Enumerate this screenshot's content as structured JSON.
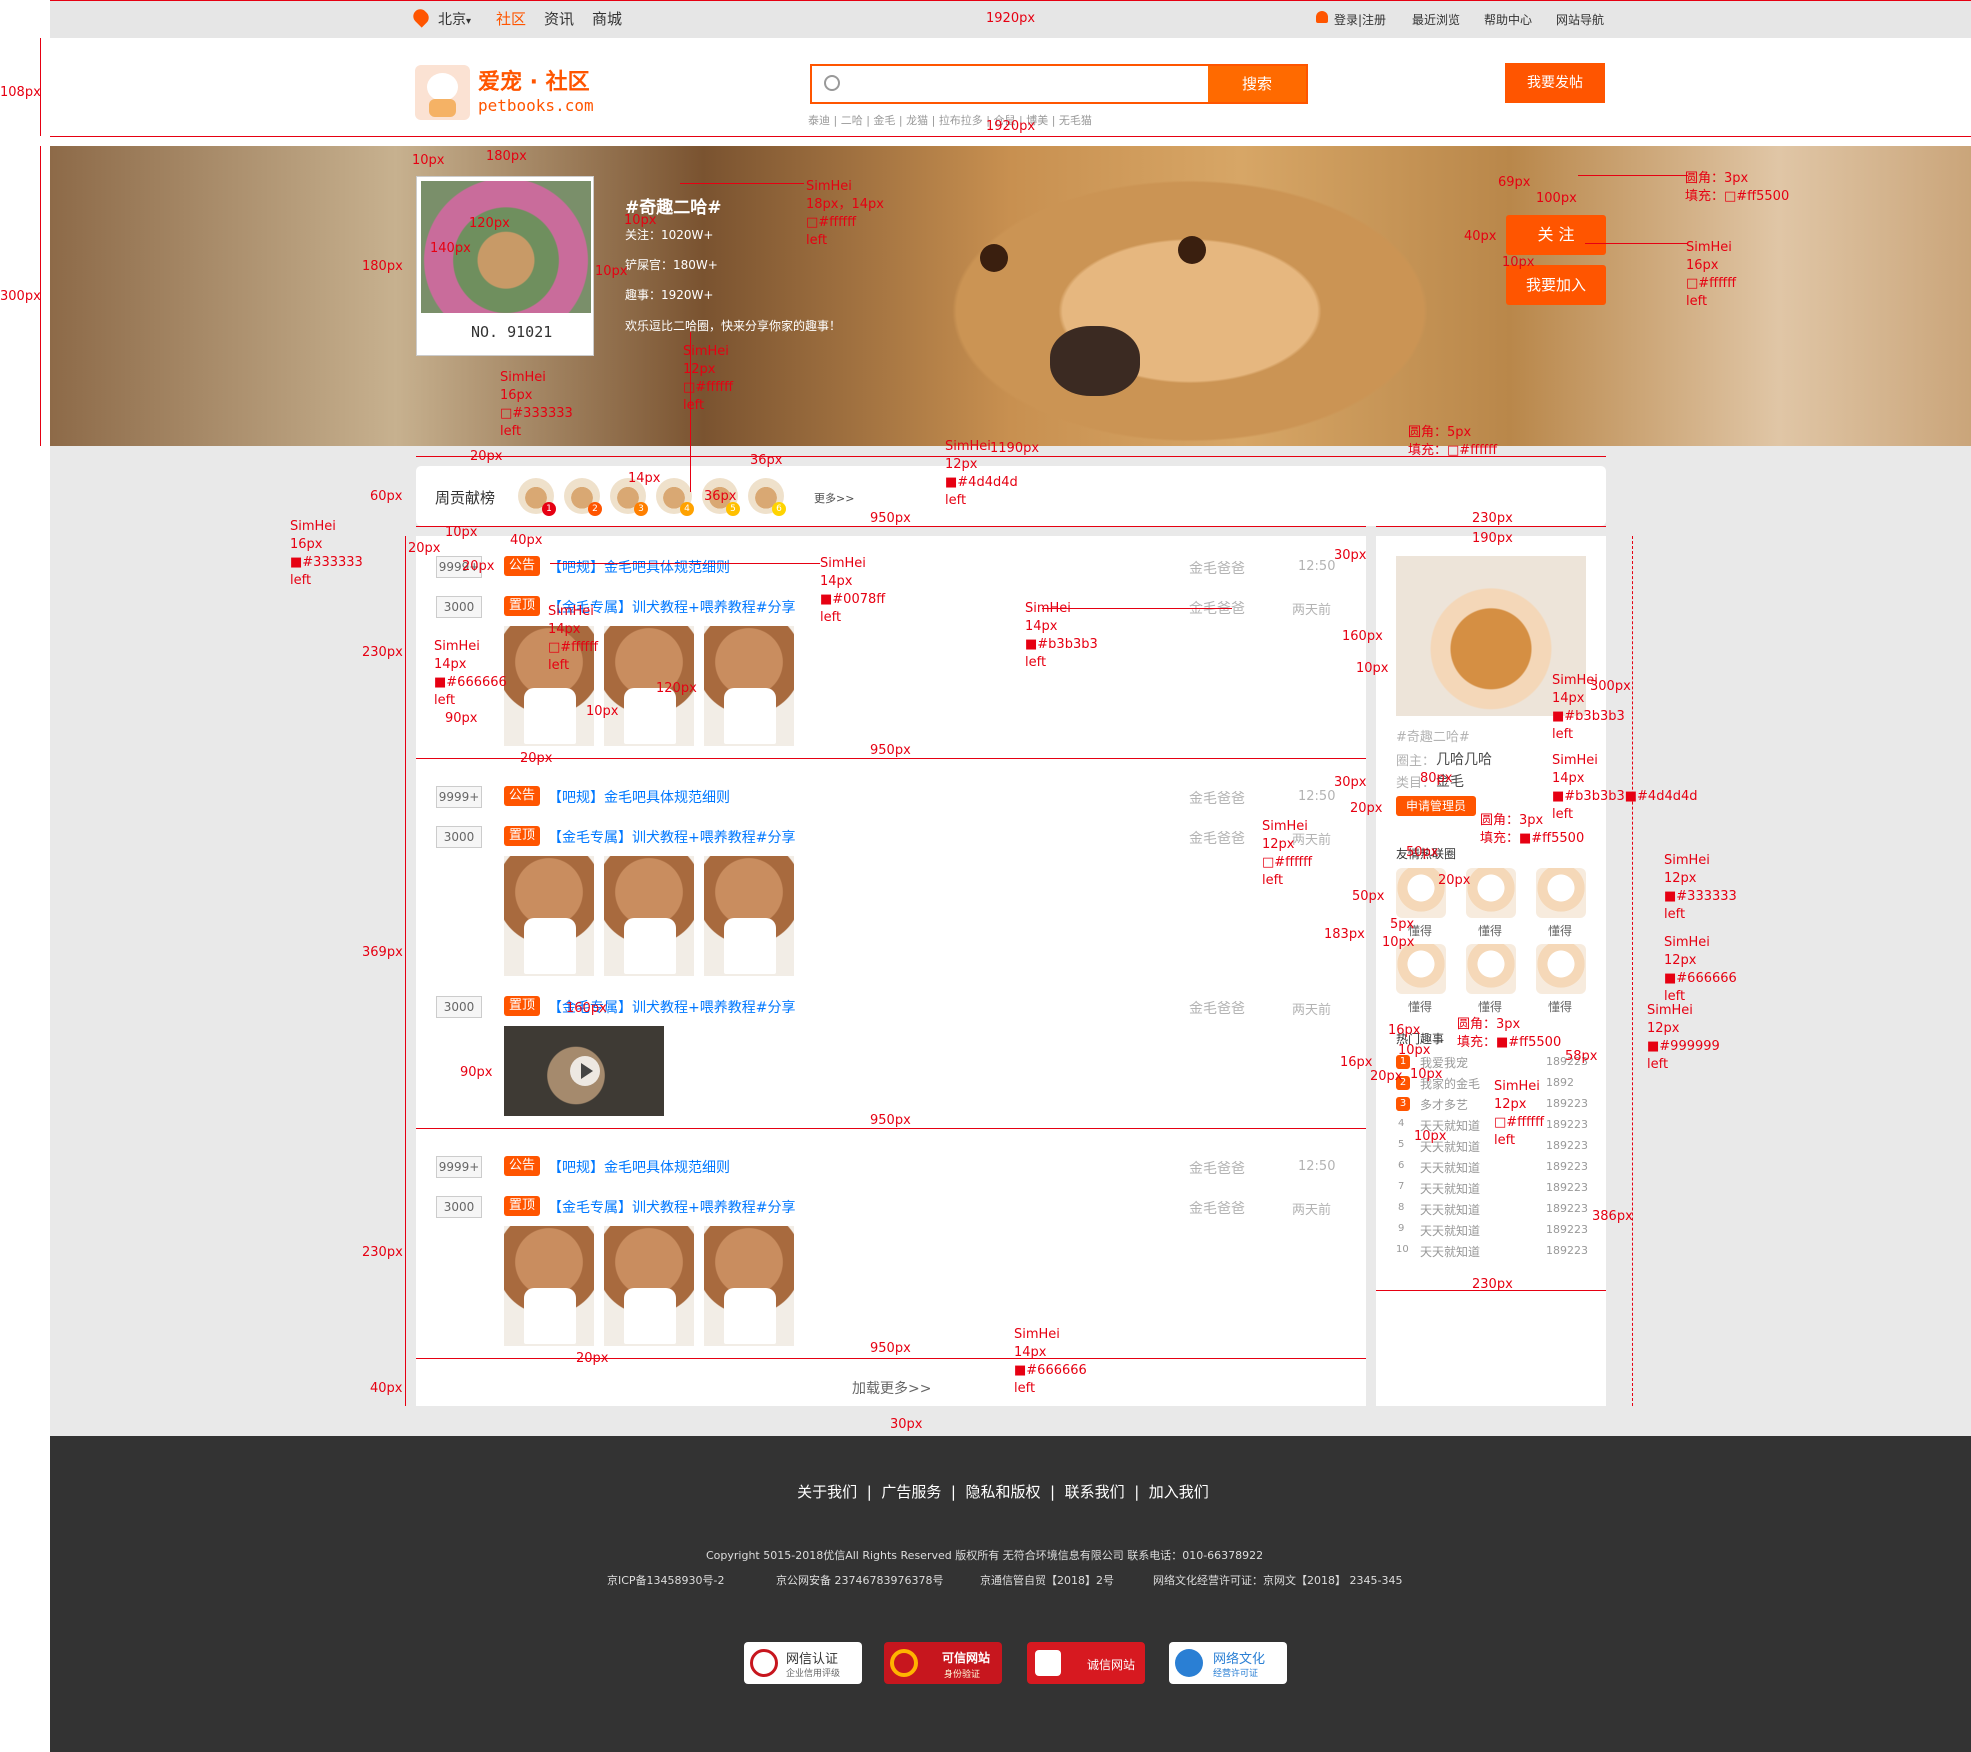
{
  "topbar": {
    "city": "北京",
    "city_arrow": "▾",
    "nav": [
      "社区",
      "资讯",
      "商城"
    ],
    "links": [
      "登录|注册",
      "最近浏览",
      "帮助中心",
      "网站导航"
    ]
  },
  "header": {
    "logo_title": "爱宠 · 社区",
    "logo_sub": "petbooks.com",
    "search_placeholder": "",
    "search_button": "搜索",
    "hot_tags": [
      "泰迪",
      "二哈",
      "金毛",
      "龙猫",
      "拉布拉多",
      "仓鼠",
      "博美",
      "无毛猫"
    ],
    "post_button": "我要发帖"
  },
  "hero": {
    "card_no": "NO. 91021",
    "topic": "#奇趣二哈#",
    "stats": [
      "关注：1020W+",
      "铲屎官：180W+",
      "趣事：1920W+"
    ],
    "desc": "欢乐逗比二哈圈，快来分享你家的趣事！",
    "follow_button": "关 注",
    "join_button": "我要加入"
  },
  "ranking": {
    "label": "周贡献榜",
    "more": "更多>>",
    "badges": [
      "1",
      "2",
      "3",
      "4",
      "5",
      "6"
    ]
  },
  "posts": [
    {
      "count1": "9999+",
      "tag1": "公告",
      "title1": "【吧规】金毛吧具体规范细则",
      "author1": "金毛爸爸",
      "time1": "12:50",
      "count2": "3000",
      "tag2": "置顶",
      "title2": "【金毛专属】训犬教程+喂养教程#分享",
      "author2": "金毛爸爸",
      "time2": "两天前"
    },
    {
      "count1": "9999+",
      "tag1": "公告",
      "title1": "【吧规】金毛吧具体规范细则",
      "author1": "金毛爸爸",
      "time1": "12:50",
      "count2": "3000",
      "tag2": "置顶",
      "title2": "【金毛专属】训犬教程+喂养教程#分享",
      "author2": "金毛爸爸",
      "time2": "两天前",
      "count3": "3000",
      "tag3": "置顶",
      "title3": "【金毛专属】训犬教程+喂养教程#分享",
      "author3": "金毛爸爸",
      "time3": "两天前"
    },
    {
      "count1": "9999+",
      "tag1": "公告",
      "title1": "【吧规】金毛吧具体规范细则",
      "author1": "金毛爸爸",
      "time1": "12:50",
      "count2": "3000",
      "tag2": "置顶",
      "title2": "【金毛专属】训犬教程+喂养教程#分享",
      "author2": "金毛爸爸",
      "time2": "两天前"
    }
  ],
  "load_more": "加载更多>>",
  "sidebar": {
    "topic": "#奇趣二哈#",
    "owner_label": "圈主：",
    "owner": "几哈几哈",
    "category_label": "类目：",
    "category": "金毛",
    "apply_button": "申请管理员",
    "friends_title": "友情热联圈",
    "friends": [
      "懂得",
      "懂得",
      "懂得",
      "懂得",
      "懂得",
      "懂得"
    ],
    "hot_title": "热门趣事",
    "hot_list": [
      {
        "rank": "1",
        "name": "我爱我宠",
        "count": "189223"
      },
      {
        "rank": "2",
        "name": "我家的金毛",
        "count": "1892"
      },
      {
        "rank": "3",
        "name": "多才多艺",
        "count": "189223"
      },
      {
        "rank": "4",
        "name": "天天就知道",
        "count": "189223"
      },
      {
        "rank": "5",
        "name": "天天就知道",
        "count": "189223"
      },
      {
        "rank": "6",
        "name": "天天就知道",
        "count": "189223"
      },
      {
        "rank": "7",
        "name": "天天就知道",
        "count": "189223"
      },
      {
        "rank": "8",
        "name": "天天就知道",
        "count": "189223"
      },
      {
        "rank": "9",
        "name": "天天就知道",
        "count": "189223"
      },
      {
        "rank": "10",
        "name": "天天就知道",
        "count": "189223"
      }
    ]
  },
  "footer": {
    "links": [
      "关于我们",
      "广告服务",
      "隐私和版权",
      "联系我们",
      "加入我们"
    ],
    "copyright": "Copyright  5015-2018优信All Rights Reserved 版权所有  无符合环境信息有限公司     联系电话：010-66378922",
    "icp": "京ICP备13458930号-2",
    "police": "京公网安备 23746783976378号",
    "telecom": "京通信管自贸【2018】2号",
    "culture": "网络文化经营许可证：京网文【2018】 2345-345",
    "badges": [
      [
        "网信认证",
        "企业信用评级"
      ],
      [
        "可信网站",
        "身份验证"
      ],
      [
        "诚信网站",
        ""
      ],
      [
        "网络文化",
        "经营许可证"
      ]
    ]
  },
  "annotations": {
    "w1920": "1920px",
    "w1920b": "1920px",
    "h108": "108px",
    "h300": "300px",
    "w180": "180px",
    "h180": "180px",
    "w10": "10px",
    "h120": "120px",
    "w140": "140px",
    "w10b": "10px",
    "h10b": "10px",
    "h10c": "10px",
    "font18": "SimHei\n18px，14px\n□#ffffff\nleft",
    "font16r": "SimHei\n16px\n□#ffffff\nleft",
    "font12w": "SimHei\n12px\n□#ffffff\nleft",
    "font16d": "SimHei\n16px\n□#333333\nleft",
    "radius3": "圆角：3px\n填充：□#ff5500",
    "h69": "69px",
    "w100": "100px",
    "h40": "40px",
    "h10": "10px",
    "w20": "20px",
    "w1190": "1190px",
    "h14": "14px",
    "w36": "36px",
    "h36": "36px",
    "font12g": "SimHei\n12px\n■#4d4d4d\nleft",
    "radius5": "圆角：5px\n填充：□#ffffff",
    "h60": "60px",
    "w950": "950px",
    "w230": "230px",
    "w190": "190px",
    "font16left": "SimHei\n16px\n■#333333\nleft",
    "h10l": "10px",
    "h20l": "20px",
    "w20l": "20px",
    "h40l": "40px",
    "font14blue": "SimHei\n14px\n■#0078ff\nleft",
    "font14w": "SimHei\n14px\n□#ffffff\nleft",
    "font14gray": "SimHei\n14px\n■#b3b3b3\nleft",
    "font14s": "SimHei\n14px\n■#666666\nleft",
    "h230": "230px",
    "w90": "90px",
    "w20b": "20px",
    "w10c": "10px",
    "h120b": "120px",
    "w30": "30px",
    "h369": "369px",
    "w160": "160px",
    "h90": "90px",
    "h230b": "230px",
    "h40b": "40px",
    "h30": "30px",
    "font14lm": "SimHei\n14px\n■#666666\nleft",
    "h160": "160px",
    "h10d": "10px",
    "h300s": "300px",
    "font14sr": "SimHei\n14px\n■#b3b3b3\nleft",
    "font14sr2": "SimHei\n14px\n■#b3b3b3■#4d4d4d\nleft",
    "w80": "80px",
    "w30b": "30px",
    "w20c": "20px",
    "radius3b": "圆角：3px\n填充：■#ff5500",
    "font12apply": "SimHei\n12px\n□#ffffff\nleft",
    "w50": "50px",
    "w20d": "20px",
    "h50": "50px",
    "h5": "5px",
    "h10e": "10px",
    "h183": "183px",
    "font12dark": "SimHei\n12px\n■#333333\nleft",
    "font12mid": "SimHei\n12px\n■#666666\nleft",
    "font12light": "SimHei\n12px\n■#999999\nleft",
    "h16": "16px",
    "h10f": "10px",
    "h16b": "16px",
    "w20e": "20px",
    "w10f": "10px",
    "radius3c": "圆角：3px\n填充：■#ff5500",
    "font12wt": "SimHei\n12px\n□#ffffff\nleft",
    "w58": "58px",
    "h10g": "10px",
    "h386": "386px",
    "w230b": "230px",
    "w20f": "20px",
    "w950b": "950px",
    "w950c": "950px",
    "w20g": "20px",
    "w950d": "950px"
  },
  "colors": {
    "accent": "#ff5500",
    "link": "#0078ff",
    "annotation": "#e60012",
    "footer_bg": "#333333"
  }
}
